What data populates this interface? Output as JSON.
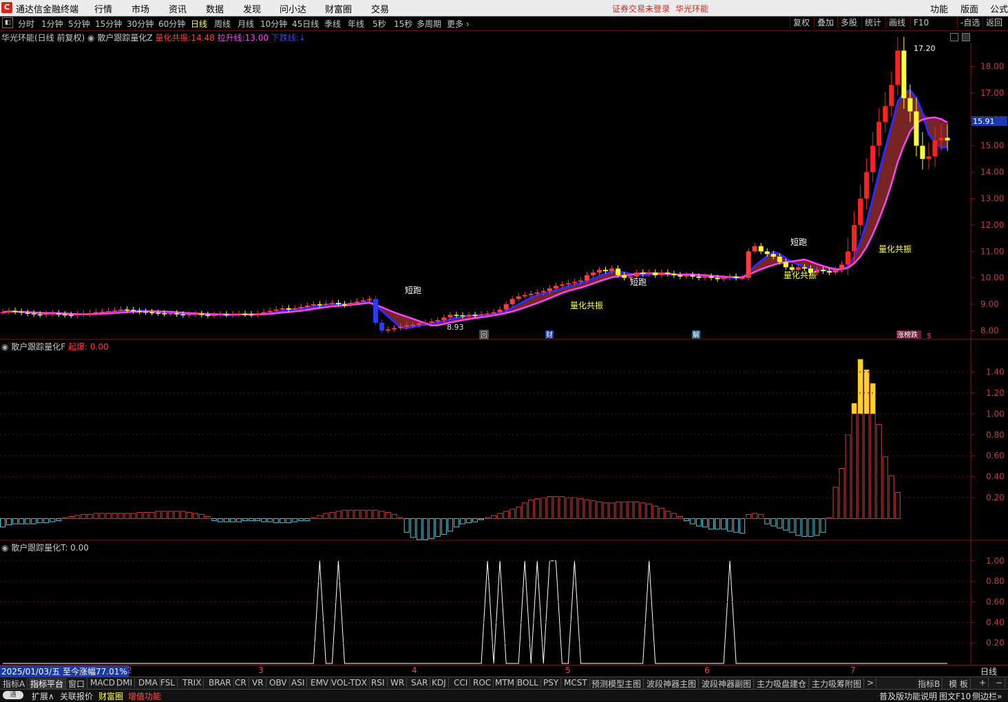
{
  "app": {
    "title": "通达信金融终端",
    "menus": [
      "行情",
      "市场",
      "资讯",
      "数据",
      "发现",
      "问小达",
      "财富圈",
      "交易"
    ],
    "notice": "证券交易未登录",
    "stock_name": "华光环能",
    "right_menus": [
      "功能",
      "版面",
      "公式"
    ]
  },
  "periods": [
    "分时",
    "1分钟",
    "5分钟",
    "15分钟",
    "30分钟",
    "60分钟",
    "日线",
    "周线",
    "月线",
    "10分钟",
    "45日线",
    "季线",
    "年线",
    "5秒",
    "15秒",
    "多周期",
    "更多"
  ],
  "active_period": "日线",
  "right_tools": [
    "复权",
    "叠加",
    "多股",
    "统计",
    "画线",
    "F10",
    "-自选",
    "返回"
  ],
  "main_panel": {
    "title": "华光环能(日线 前复权)",
    "indicator": "散户跟踪量化Z",
    "legend": [
      {
        "label": "量化共振:",
        "value": "14.48",
        "color": "#ff3c3c"
      },
      {
        "label": "拉升线:",
        "value": "13.00",
        "color": "#ff40ff"
      },
      {
        "label": "下跌线:",
        "value": "",
        "color": "#3c3cff"
      }
    ],
    "price_tag": "15.91",
    "high_label": "17.20",
    "low_label": "8.93",
    "annotations": [
      "短跑",
      "量化共振",
      "短跑",
      "量化共振",
      "短跑",
      "量化共振"
    ],
    "event_tags": [
      "回",
      "财",
      "解",
      "涨榜跌",
      "$"
    ]
  },
  "sub1": {
    "title": "散户跟踪量化F",
    "legend_label": "起爆:",
    "legend_value": "0.00"
  },
  "sub2": {
    "title": "散户跟踪量化T",
    "legend_value": ": 0.00"
  },
  "datebar": {
    "first": "2025/01/03/五  至今涨幅77.01%",
    "months": [
      "2",
      "3",
      "4",
      "5",
      "6",
      "7"
    ],
    "right": "日线"
  },
  "tabs": [
    "指标A",
    "指标平台",
    "窗口",
    "MACD",
    "DMI",
    "DMA",
    "FSL",
    "TRIX",
    "BRAR",
    "CR",
    "VR",
    "OBV",
    "ASI",
    "EMV",
    "VOL-TDX",
    "RSI",
    "WR",
    "SAR",
    "KDJ",
    "CCI",
    "ROC",
    "MTM",
    "BOLL",
    "PSY",
    "MCST",
    "预测模型主图",
    "波段神器主图",
    "波段神器副图",
    "主力吸盘建仓",
    "主力吸筹附图",
    ">"
  ],
  "tabs_right": [
    "指标B",
    "模 板",
    "+",
    "−"
  ],
  "statusbar": {
    "toggle": "通",
    "items": [
      "扩展∧",
      "关联报价",
      "财富圈",
      "增值功能"
    ],
    "right": [
      "普及版功能说明",
      "图文F10",
      "侧边栏»"
    ]
  },
  "chart_data": [
    {
      "type": "candlestick",
      "title": "华光环能(日线 前复权)",
      "y_ticks": [
        8.0,
        9.0,
        10.0,
        11.0,
        12.0,
        13.0,
        14.0,
        15.0,
        16.0,
        17.0,
        18.0
      ],
      "ylim": [
        7.7,
        18.9
      ],
      "x_months": [
        "2",
        "3",
        "4",
        "5",
        "6",
        "7"
      ],
      "close": [
        8.7,
        8.75,
        8.72,
        8.68,
        8.66,
        8.62,
        8.6,
        8.64,
        8.66,
        8.62,
        8.6,
        8.58,
        8.62,
        8.64,
        8.66,
        8.7,
        8.72,
        8.74,
        8.76,
        8.8,
        8.78,
        8.74,
        8.72,
        8.7,
        8.68,
        8.66,
        8.64,
        8.66,
        8.62,
        8.6,
        8.62,
        8.64,
        8.6,
        8.58,
        8.6,
        8.62,
        8.6,
        8.62,
        8.64,
        8.62,
        8.6,
        8.64,
        8.7,
        8.75,
        8.8,
        8.85,
        8.8,
        8.85,
        8.9,
        8.95,
        9.0,
        8.98,
        9.02,
        9.05,
        9.0,
        8.98,
        9.05,
        9.1,
        9.15,
        9.2,
        8.3,
        8.0,
        8.05,
        8.1,
        8.15,
        8.2,
        8.22,
        8.28,
        8.3,
        8.35,
        8.4,
        8.5,
        8.6,
        8.58,
        8.55,
        8.6,
        8.58,
        8.62,
        8.65,
        8.7,
        8.8,
        9.0,
        9.2,
        9.3,
        9.35,
        9.4,
        9.45,
        9.5,
        9.6,
        9.7,
        9.75,
        9.8,
        9.85,
        9.9,
        10.1,
        10.2,
        10.3,
        10.25,
        10.35,
        10.1,
        10.0,
        10.05,
        10.2,
        10.15,
        10.2,
        10.1,
        10.2,
        10.15,
        10.1,
        10.05,
        10.1,
        10.05,
        10.0,
        10.05,
        10.0,
        9.95,
        10.0,
        10.05,
        10.0,
        10.0,
        11.0,
        11.2,
        11.0,
        10.9,
        10.8,
        10.6,
        10.4,
        10.3,
        10.4,
        10.35,
        10.2,
        10.3,
        10.25,
        10.2,
        10.3,
        10.5,
        11.0,
        12.0,
        13.0,
        14.0,
        15.0,
        15.9,
        16.5,
        17.3,
        18.6,
        16.8,
        16.3,
        15.0,
        14.5,
        14.6,
        15.2,
        15.3,
        15.2
      ],
      "lines": [
        {
          "name": "拉升线",
          "color": "#ff40ff"
        },
        {
          "name": "下跌线",
          "color": "#3c3cff"
        }
      ]
    },
    {
      "type": "bar",
      "title": "散户跟踪量化F",
      "y_ticks": [
        0.2,
        0.4,
        0.6,
        0.8,
        1.0,
        1.2,
        1.4
      ],
      "ylim": [
        -0.2,
        1.6
      ],
      "values": [
        -0.08,
        -0.06,
        -0.05,
        -0.05,
        -0.05,
        -0.05,
        -0.04,
        -0.04,
        -0.03,
        -0.02,
        0.01,
        0.02,
        0.03,
        0.04,
        0.04,
        0.05,
        0.05,
        0.05,
        0.05,
        0.05,
        0.05,
        0.05,
        0.06,
        0.06,
        0.06,
        0.07,
        0.07,
        0.07,
        0.07,
        0.07,
        0.06,
        0.05,
        0.04,
        0.02,
        -0.02,
        -0.03,
        -0.03,
        -0.03,
        -0.03,
        -0.02,
        -0.02,
        -0.02,
        -0.03,
        -0.03,
        -0.04,
        -0.04,
        -0.04,
        -0.03,
        -0.02,
        -0.02,
        0.01,
        0.03,
        0.05,
        0.06,
        0.07,
        0.08,
        0.08,
        0.08,
        0.08,
        0.08,
        0.08,
        0.07,
        0.06,
        0.04,
        0.01,
        -0.13,
        -0.18,
        -0.2,
        -0.2,
        -0.19,
        -0.17,
        -0.15,
        -0.12,
        -0.08,
        -0.05,
        -0.04,
        -0.03,
        -0.01,
        0.01,
        0.03,
        0.05,
        0.07,
        0.09,
        0.11,
        0.15,
        0.18,
        0.19,
        0.2,
        0.21,
        0.21,
        0.21,
        0.2,
        0.2,
        0.19,
        0.18,
        0.17,
        0.16,
        0.15,
        0.15,
        0.16,
        0.16,
        0.16,
        0.16,
        0.15,
        0.14,
        0.12,
        0.1,
        0.07,
        0.05,
        0.02,
        -0.02,
        -0.05,
        -0.07,
        -0.08,
        -0.1,
        -0.1,
        -0.1,
        -0.12,
        -0.13,
        -0.14,
        0.04,
        0.05,
        0.04,
        -0.05,
        -0.07,
        -0.09,
        -0.11,
        -0.13,
        -0.16,
        -0.17,
        -0.17,
        -0.16,
        -0.13,
        0.01,
        0.3,
        0.48,
        0.8,
        1.1,
        1.52,
        1.42,
        1.29,
        0.9,
        0.59,
        0.41,
        0.25
      ],
      "threshold": 1.0
    },
    {
      "type": "line",
      "title": "散户跟踪量化T",
      "y_ticks": [
        0.2,
        0.4,
        0.6,
        0.8,
        1.0
      ],
      "ylim": [
        0,
        1.1
      ],
      "spike_indices": [
        51,
        54,
        78,
        80,
        84,
        86,
        88,
        89,
        92,
        104,
        117
      ],
      "spike_value": 1.0
    }
  ]
}
